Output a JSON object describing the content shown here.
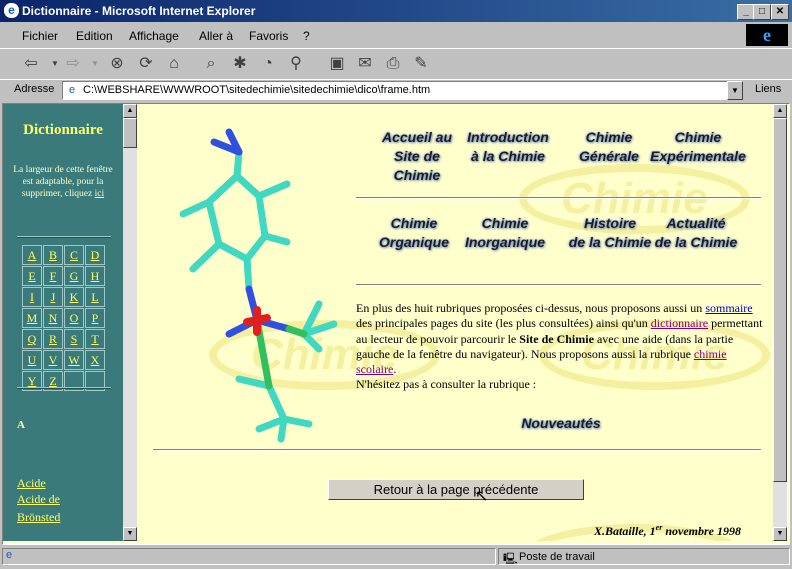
{
  "window": {
    "title": "Dictionnaire - Microsoft Internet Explorer",
    "app_icon": "e",
    "min": "_",
    "max": "□",
    "close": "✕"
  },
  "menu": {
    "items": [
      "Fichier",
      "Edition",
      "Affichage",
      "Aller à",
      "Favoris",
      "?"
    ]
  },
  "address": {
    "label": "Adresse",
    "url": "C:\\WEBSHARE\\WWWROOT\\sitedechimie\\sitedechimie\\dico\\frame.htm",
    "links_label": "Liens"
  },
  "left_frame": {
    "title": "Dictionnaire",
    "note": "La largeur de cette fenêtre est adaptable, pour la supprimer, cliquez",
    "note_link": "ici",
    "letters": [
      "A",
      "B",
      "C",
      "D",
      "E",
      "F",
      "G",
      "H",
      "I",
      "J",
      "K",
      "L",
      "M",
      "N",
      "O",
      "P",
      "Q",
      "R",
      "S",
      "T",
      "U",
      "V",
      "W",
      "X",
      "Y",
      "Z"
    ],
    "section_letter": "A",
    "entries": [
      "Acide",
      "Acide de",
      "Brönsted"
    ]
  },
  "main": {
    "watermark": "Chimie",
    "nav_row1": [
      "Accueil au\nSite de Chimie",
      "Introduction\nà la Chimie",
      "Chimie\nGénérale",
      "Chimie\nExpérimentale"
    ],
    "nav_row2": [
      "Chimie\nOrganique",
      "Chimie\nInorganique",
      "Histoire\nde la Chimie",
      "Actualité\nde la Chimie"
    ],
    "paragraph": {
      "t1": "En plus des huit rubriques proposées ci-dessus, nous proposons aussi un",
      "link_sommaire": "sommaire",
      "t2": " des principales pages du site (les plus consultées) ainsi qu'un",
      "link_dictionnaire": "dictionnaire",
      "t3": " permettant au lecteur de pouvoir parcourir le ",
      "site_name": "Site de Chimie",
      "t4": " avec une aide (dans la partie gauche de la fenêtre du navigateur). Nous proposons aussi la rubrique ",
      "link_scolaire": "chimie scolaire",
      "t5": ".",
      "t6": "N'hésitez pas à consulter la rubrique :"
    },
    "nouveautes": "Nouveautés",
    "back_button": "Retour à la page précédente",
    "signature": {
      "author": "X.Bataille, 1",
      "sup": "er",
      "date": " novembre 1998"
    }
  },
  "status": {
    "zone": "Poste de travail"
  },
  "colors": {
    "left_frame_bg": "#3a7a7a",
    "main_bg": "#ffffcc",
    "link_yellow": "#ffff66",
    "title_bar": "#0a246a"
  }
}
